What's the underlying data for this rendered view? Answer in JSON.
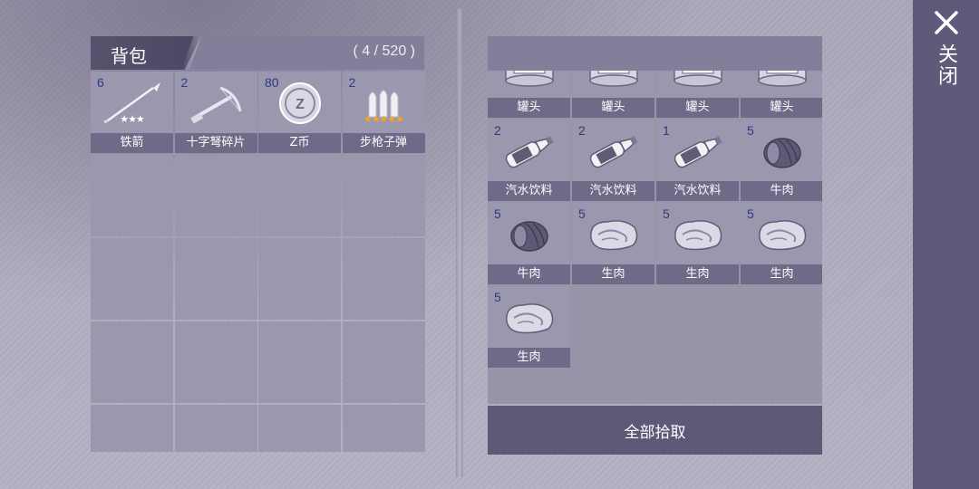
{
  "backpack": {
    "title": "背包",
    "count": "( 4 / 520 )",
    "items": [
      {
        "qty": "6",
        "label": "铁箭",
        "icon": "iron-arrow-icon",
        "stars": "★★★",
        "star_color": "#ffffff"
      },
      {
        "qty": "2",
        "label": "十字弩碎片",
        "icon": "crossbow-fragment-icon"
      },
      {
        "qty": "80",
        "label": "Z币",
        "icon": "z-coin-icon"
      },
      {
        "qty": "2",
        "label": "步枪子弹",
        "icon": "rifle-bullet-icon",
        "stars": "★★★★★",
        "star_color": "#f5a623"
      }
    ],
    "empty_slots": 16
  },
  "loot": {
    "items": [
      {
        "qty": "",
        "label": "罐头",
        "icon": "canned-food-icon"
      },
      {
        "qty": "",
        "label": "罐头",
        "icon": "canned-food-icon"
      },
      {
        "qty": "",
        "label": "罐头",
        "icon": "canned-food-icon"
      },
      {
        "qty": "",
        "label": "罐头",
        "icon": "canned-food-icon"
      },
      {
        "qty": "2",
        "label": "汽水饮料",
        "icon": "soda-bottle-icon"
      },
      {
        "qty": "2",
        "label": "汽水饮料",
        "icon": "soda-bottle-icon"
      },
      {
        "qty": "1",
        "label": "汽水饮料",
        "icon": "soda-bottle-icon"
      },
      {
        "qty": "5",
        "label": "牛肉",
        "icon": "roast-beef-icon"
      },
      {
        "qty": "5",
        "label": "牛肉",
        "icon": "roast-beef-icon"
      },
      {
        "qty": "5",
        "label": "生肉",
        "icon": "raw-meat-icon"
      },
      {
        "qty": "5",
        "label": "生肉",
        "icon": "raw-meat-icon"
      },
      {
        "qty": "5",
        "label": "生肉",
        "icon": "raw-meat-icon"
      },
      {
        "qty": "5",
        "label": "生肉",
        "icon": "raw-meat-icon"
      }
    ],
    "pickup_all_label": "全部拾取"
  },
  "close": {
    "label": "关闭"
  },
  "colors": {
    "qty_text": "#2a3c7c",
    "label_bg": "#6e6a87",
    "cell_bg": "#9a97ae",
    "button_bg": "#5d5876",
    "close_bar_bg": "#5f5a7a"
  }
}
